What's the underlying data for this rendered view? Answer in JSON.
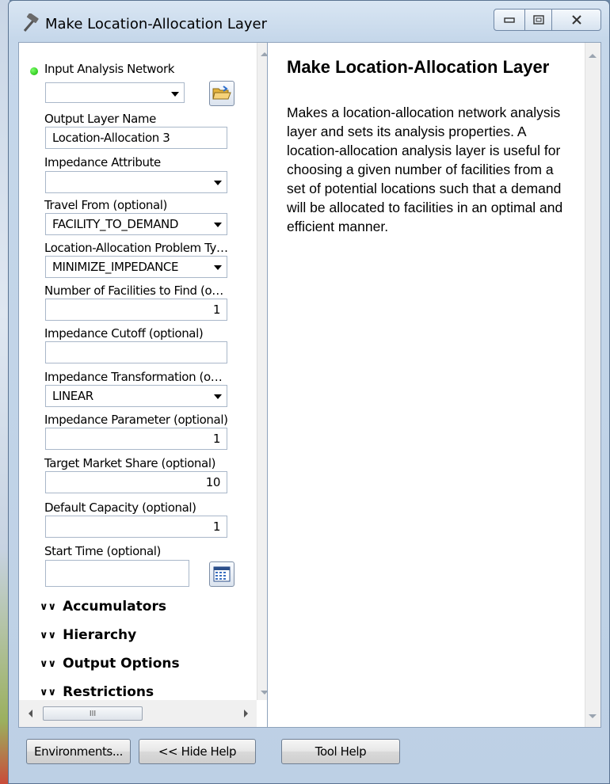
{
  "window": {
    "title": "Make Location-Allocation Layer",
    "title_icon": "hammer-icon",
    "controls": [
      "minimize-icon",
      "maximize-icon",
      "close-icon"
    ]
  },
  "params": {
    "input_network": {
      "label": "Input Analysis Network",
      "value": ""
    },
    "output_layer": {
      "label": "Output Layer Name",
      "value": "Location-Allocation 3"
    },
    "impedance_attr": {
      "label": "Impedance Attribute",
      "value": ""
    },
    "travel_from": {
      "label": "Travel From (optional)",
      "value": "FACILITY_TO_DEMAND"
    },
    "problem_type": {
      "label": "Location-Allocation Problem Ty…",
      "value": "MINIMIZE_IMPEDANCE"
    },
    "num_facilities": {
      "label": "Number of Facilities to Find (o…",
      "value": "1"
    },
    "impedance_cutoff": {
      "label": "Impedance Cutoff (optional)",
      "value": ""
    },
    "impedance_transform": {
      "label": "Impedance Transformation (o…",
      "value": "LINEAR"
    },
    "impedance_param": {
      "label": "Impedance Parameter (optional)",
      "value": "1"
    },
    "target_share": {
      "label": "Target Market Share (optional)",
      "value": "10"
    },
    "default_capacity": {
      "label": "Default Capacity (optional)",
      "value": "1"
    },
    "start_time": {
      "label": "Start Time (optional)",
      "value": ""
    }
  },
  "sections": {
    "accumulators": "Accumulators",
    "hierarchy": "Hierarchy",
    "output_options": "Output Options",
    "restrictions": "Restrictions"
  },
  "scroll_thumb_grip": "III",
  "help": {
    "title": "Make Location-Allocation Layer",
    "body": "Makes a location-allocation network analysis layer and sets its analysis properties. A location-allocation analysis layer is useful for choosing a given number of facilities from a set of potential locations such that a demand will be allocated to facilities in an optimal and efficient manner."
  },
  "buttons": {
    "environments": "Environments...",
    "hide_help": "<< Hide Help",
    "tool_help": "Tool Help"
  },
  "colors": {
    "required_dot": "#11b300",
    "title_bar": "#c5d7ea"
  }
}
